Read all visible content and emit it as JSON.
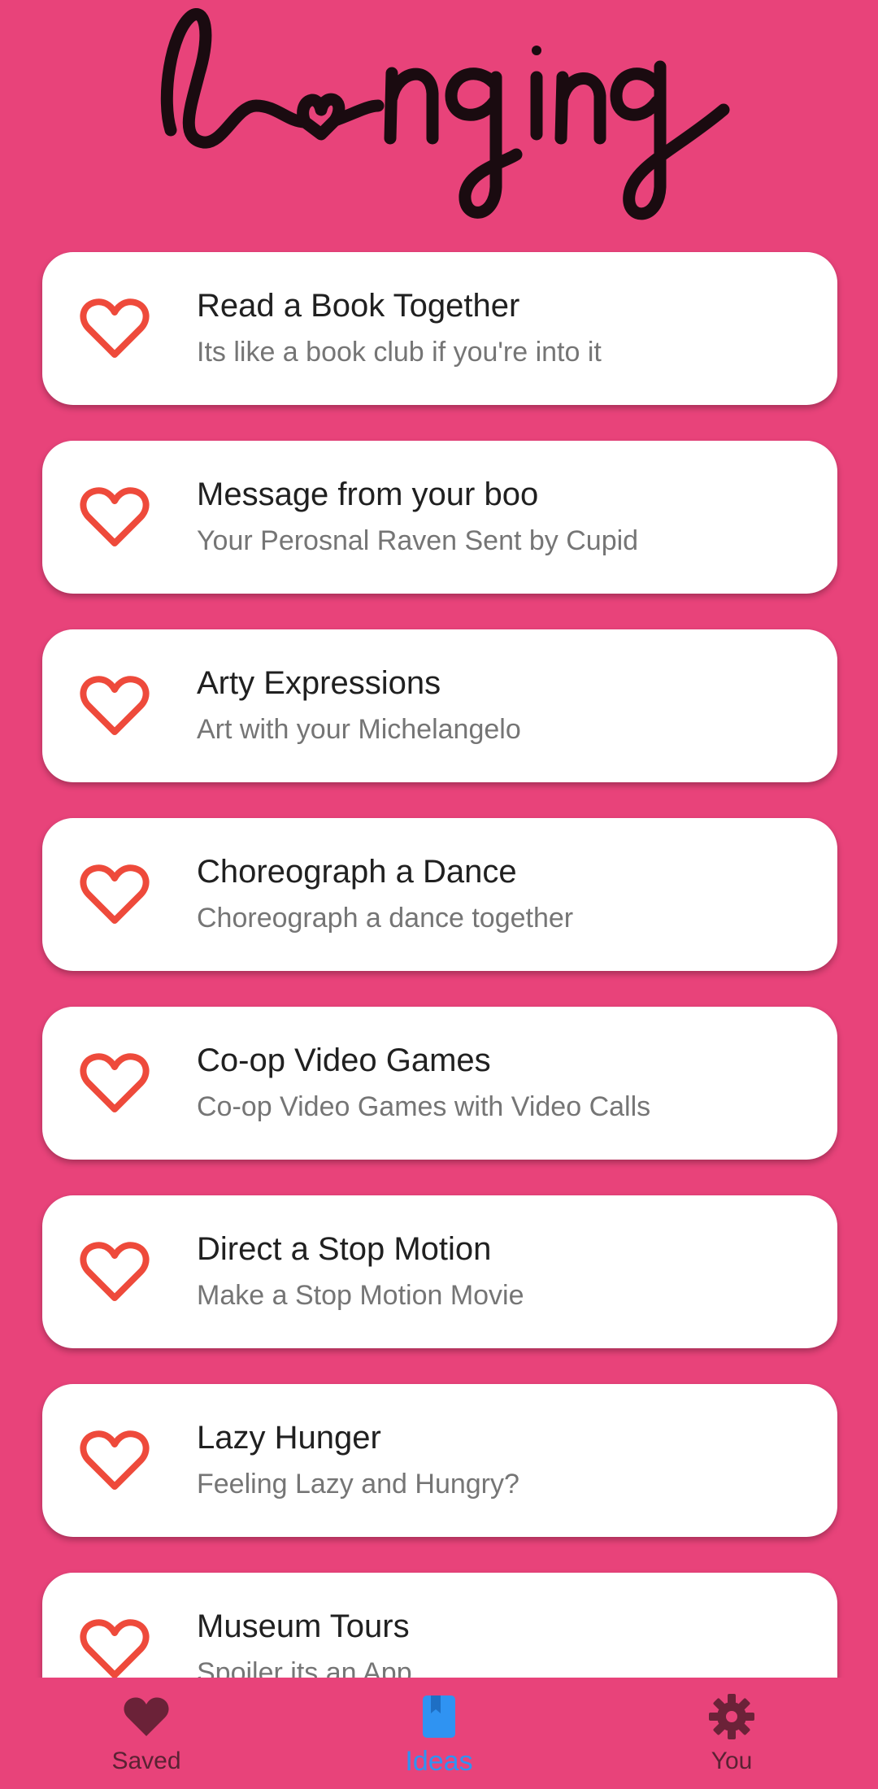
{
  "app": {
    "logo_text": "longing"
  },
  "colors": {
    "background": "#E8437A",
    "card": "#FFFFFF",
    "heart_outline": "#EE4A3B",
    "active_tab": "#2F93F2",
    "inactive_tab": "#6B2238"
  },
  "ideas": [
    {
      "title": "Read a Book Together",
      "subtitle": "Its like a book club if you're into it",
      "icon": "heart-outline-icon"
    },
    {
      "title": "Message from your boo",
      "subtitle": "Your Perosnal Raven Sent by Cupid",
      "icon": "heart-outline-icon"
    },
    {
      "title": "Arty Expressions",
      "subtitle": "Art with your Michelangelo",
      "icon": "heart-outline-icon"
    },
    {
      "title": "Choreograph a Dance",
      "subtitle": "Choreograph a dance together",
      "icon": "heart-outline-icon"
    },
    {
      "title": "Co-op Video Games",
      "subtitle": "Co-op Video Games with Video Calls",
      "icon": "heart-outline-icon"
    },
    {
      "title": "Direct a Stop Motion",
      "subtitle": "Make a Stop Motion Movie",
      "icon": "heart-outline-icon"
    },
    {
      "title": "Lazy Hunger",
      "subtitle": "Feeling Lazy and Hungry?",
      "icon": "heart-outline-icon"
    },
    {
      "title": "Museum Tours",
      "subtitle": "Spoiler its an App",
      "icon": "heart-outline-icon"
    }
  ],
  "bottom_nav": {
    "items": [
      {
        "label": "Saved",
        "icon": "heart-filled-icon",
        "active": false
      },
      {
        "label": "Ideas",
        "icon": "book-icon",
        "active": true
      },
      {
        "label": "You",
        "icon": "gear-icon",
        "active": false
      }
    ]
  }
}
